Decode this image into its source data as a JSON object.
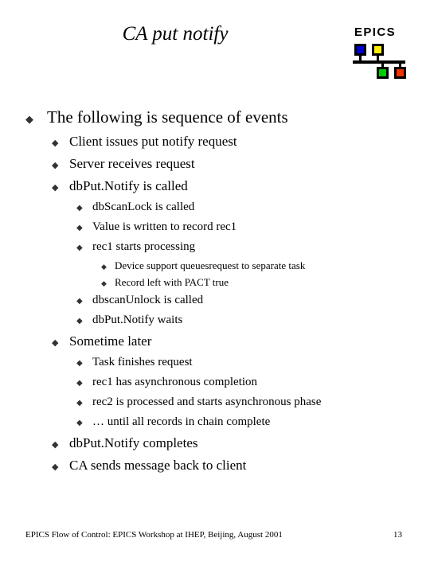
{
  "slide": {
    "title": "CA put notify",
    "logo": {
      "wordmark": "EPICS",
      "square_colors": {
        "top_left": "#0000cc",
        "top_right": "#ffee00",
        "bottom_left": "#00cc00",
        "bottom_right": "#ee3300"
      },
      "line_color": "#000000"
    },
    "bullets": [
      {
        "level": 1,
        "marker": "diamond-bullet",
        "text": "The following is sequence of events"
      },
      {
        "level": 2,
        "marker": "diamond-bullet",
        "text": "Client issues put notify request"
      },
      {
        "level": 2,
        "marker": "diamond-bullet",
        "text": "Server receives request"
      },
      {
        "level": 2,
        "marker": "diamond-bullet",
        "text": "dbPut.Notify is called"
      },
      {
        "level": 3,
        "marker": "diamond-bullet",
        "text": "dbScanLock is called"
      },
      {
        "level": 3,
        "marker": "diamond-bullet",
        "text": "Value is written to record rec1"
      },
      {
        "level": 3,
        "marker": "diamond-bullet",
        "text": "rec1 starts processing"
      },
      {
        "level": 4,
        "marker": "diamond-bullet",
        "text": "Device support queuesrequest to separate task"
      },
      {
        "level": 4,
        "marker": "diamond-bullet",
        "text": "Record left with PACT true"
      },
      {
        "level": 3,
        "marker": "diamond-bullet",
        "text": "dbscanUnlock is called"
      },
      {
        "level": 3,
        "marker": "diamond-bullet",
        "text": "dbPut.Notify waits"
      },
      {
        "level": 2,
        "marker": "diamond-bullet",
        "text": "Sometime later"
      },
      {
        "level": 3,
        "marker": "diamond-bullet",
        "text": "Task finishes request"
      },
      {
        "level": 3,
        "marker": "diamond-bullet",
        "text": "rec1 has asynchronous completion"
      },
      {
        "level": 3,
        "marker": "diamond-bullet",
        "text": "rec2 is processed and starts asynchronous phase"
      },
      {
        "level": 3,
        "marker": "diamond-bullet",
        "text": "… until all records in chain complete"
      },
      {
        "level": 2,
        "marker": "diamond-bullet",
        "text": "dbPut.Notify completes"
      },
      {
        "level": 2,
        "marker": "diamond-bullet",
        "text": "CA sends message back to client"
      }
    ],
    "bullet_glyph": "◆",
    "footer": {
      "note": "EPICS Flow of Control: EPICS Workshop at IHEP, Beijing, August 2001",
      "page_number": "13"
    }
  }
}
